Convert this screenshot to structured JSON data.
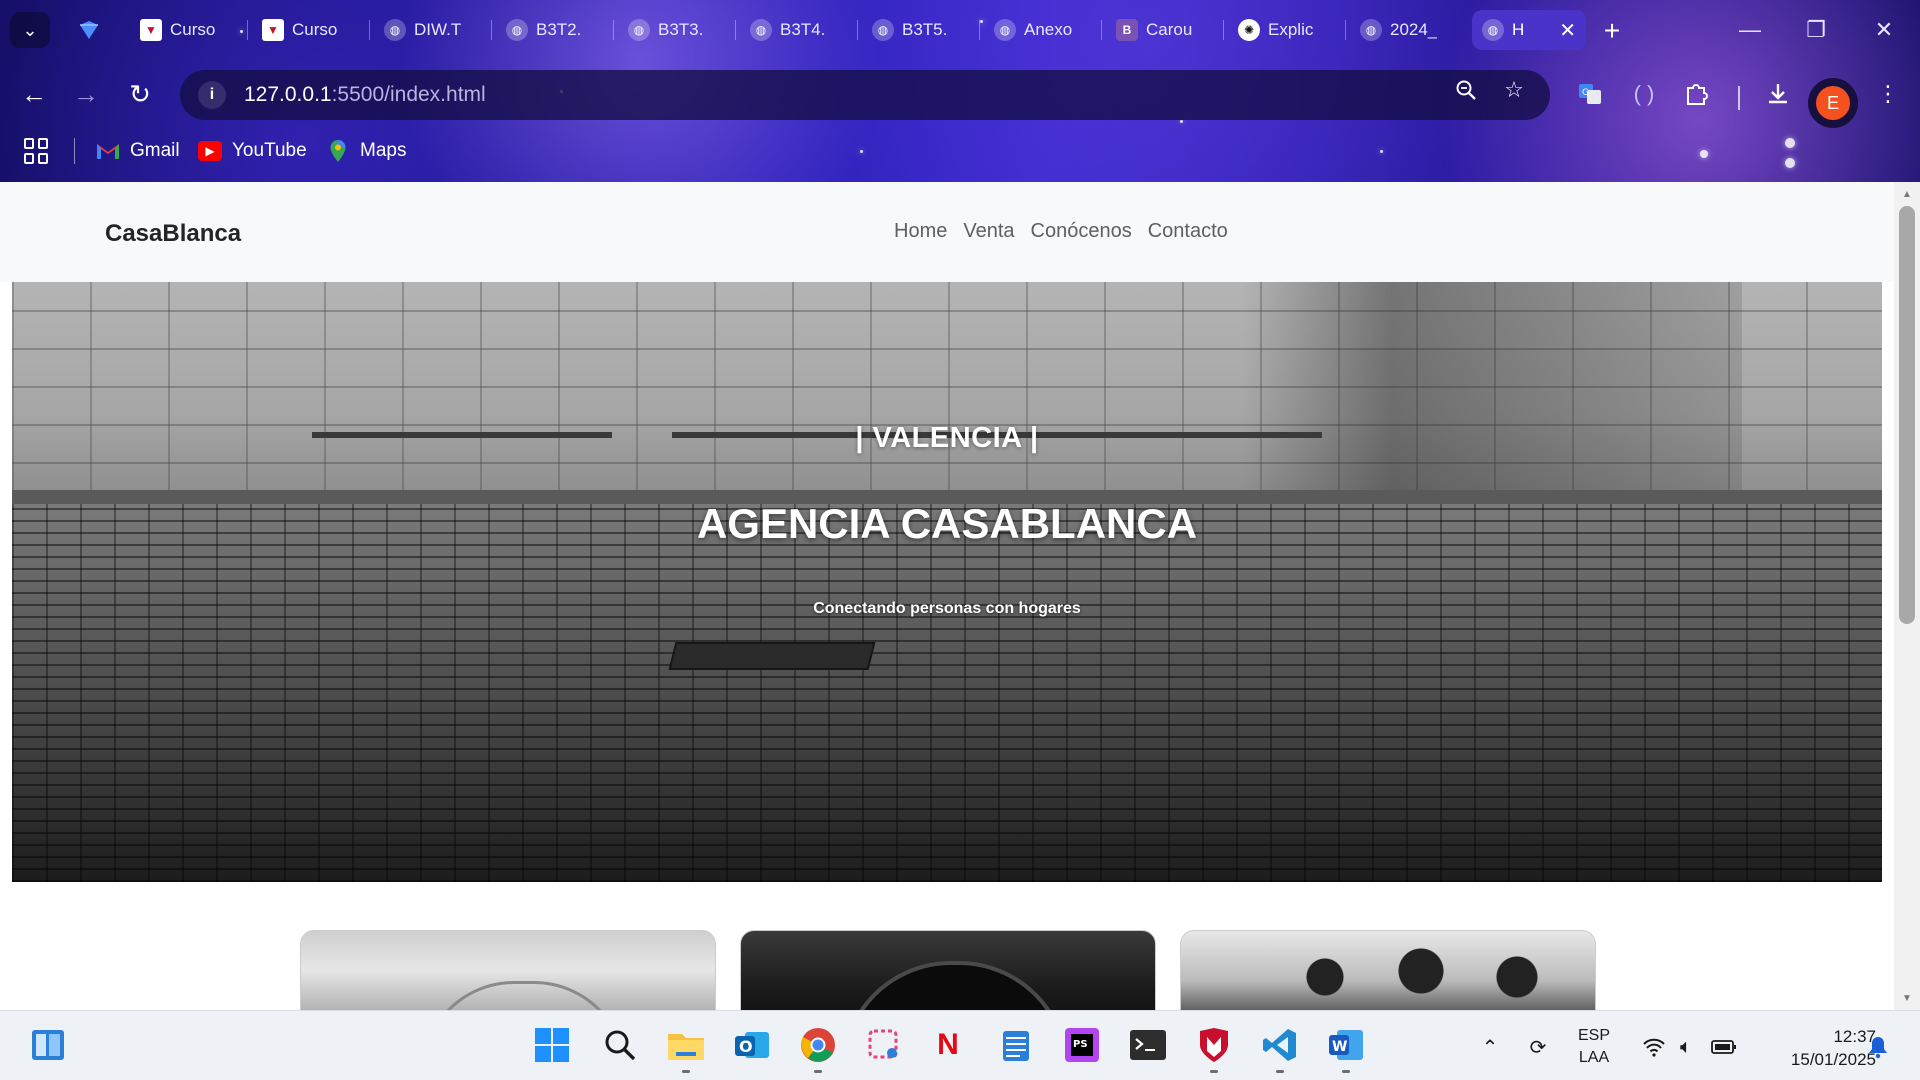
{
  "browser": {
    "tabs": [
      {
        "label": "Curso",
        "favicon": "shield-red"
      },
      {
        "label": "Curso",
        "favicon": "shield-red"
      },
      {
        "label": "DIW.T",
        "favicon": "globe"
      },
      {
        "label": "B3T2.",
        "favicon": "globe"
      },
      {
        "label": "B3T3.",
        "favicon": "globe"
      },
      {
        "label": "B3T4.",
        "favicon": "globe"
      },
      {
        "label": "B3T5.",
        "favicon": "globe"
      },
      {
        "label": "Anexo",
        "favicon": "globe"
      },
      {
        "label": "Carou",
        "favicon": "bootstrap"
      },
      {
        "label": "Explic",
        "favicon": "openai"
      },
      {
        "label": "2024_",
        "favicon": "globe"
      }
    ],
    "active_tab": {
      "label": "H",
      "favicon": "globe",
      "close": "✕"
    },
    "new_tab": "+",
    "address": {
      "host": "127.0.0.1",
      "path": ":5500/index.html"
    },
    "profile_initial": "E",
    "bookmarks": [
      {
        "label": "Gmail",
        "icon": "gmail-icon"
      },
      {
        "label": "YouTube",
        "icon": "youtube-icon"
      },
      {
        "label": "Maps",
        "icon": "maps-icon"
      }
    ]
  },
  "site": {
    "brand": "CasaBlanca",
    "nav": [
      "Home",
      "Venta",
      "Conócenos",
      "Contacto"
    ],
    "hero": {
      "kicker": "| VALENCIA |",
      "title": "AGENCIA CASABLANCA",
      "subtitle": "Conectando personas con hogares"
    }
  },
  "taskbar": {
    "language": {
      "line1": "ESP",
      "line2": "LAA"
    },
    "time": "12:37",
    "date": "15/01/2025"
  },
  "colors": {
    "accent_tab": "#4a33c9",
    "profile": "#f4511e",
    "navbar_bg": "#f8f9fa"
  }
}
